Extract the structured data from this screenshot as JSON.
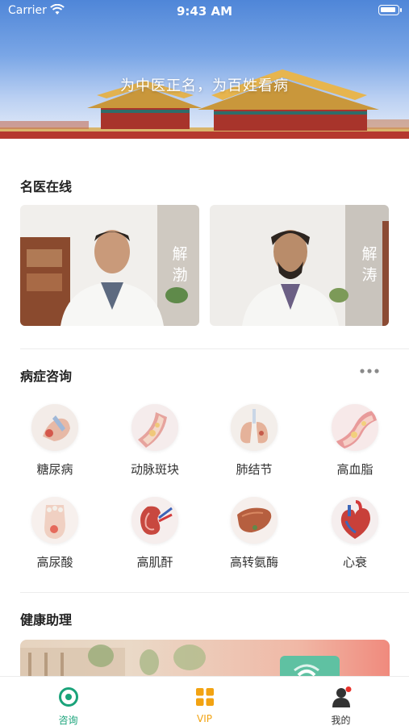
{
  "status_bar": {
    "carrier": "Carrier",
    "time": "9:43 AM"
  },
  "hero": {
    "slogan": "为中医正名，为百姓看病"
  },
  "sections": {
    "doctors_title": "名医在线",
    "symptoms_title": "病症咨询",
    "assistant_title": "健康助理"
  },
  "doctors": [
    {
      "name": "解渤"
    },
    {
      "name": "解涛"
    }
  ],
  "symptoms": [
    {
      "label": "糖尿病",
      "icon": "diabetes-icon"
    },
    {
      "label": "动脉斑块",
      "icon": "artery-plaque-icon"
    },
    {
      "label": "肺结节",
      "icon": "lung-nodule-icon"
    },
    {
      "label": "高血脂",
      "icon": "hyperlipidemia-icon"
    },
    {
      "label": "高尿酸",
      "icon": "hyperuricemia-icon"
    },
    {
      "label": "高肌酐",
      "icon": "kidney-icon"
    },
    {
      "label": "高转氨酶",
      "icon": "liver-icon"
    },
    {
      "label": "心衰",
      "icon": "heart-icon"
    }
  ],
  "tabbar": {
    "tabs": [
      {
        "label": "咨询",
        "icon": "consult-icon",
        "active": true
      },
      {
        "label": "VIP",
        "icon": "vip-grid-icon",
        "active": false
      },
      {
        "label": "我的",
        "icon": "profile-icon",
        "active": false
      }
    ]
  },
  "colors": {
    "accent_green": "#1aa37a",
    "vip_orange": "#f2a312",
    "badge_red": "#e8322b"
  }
}
